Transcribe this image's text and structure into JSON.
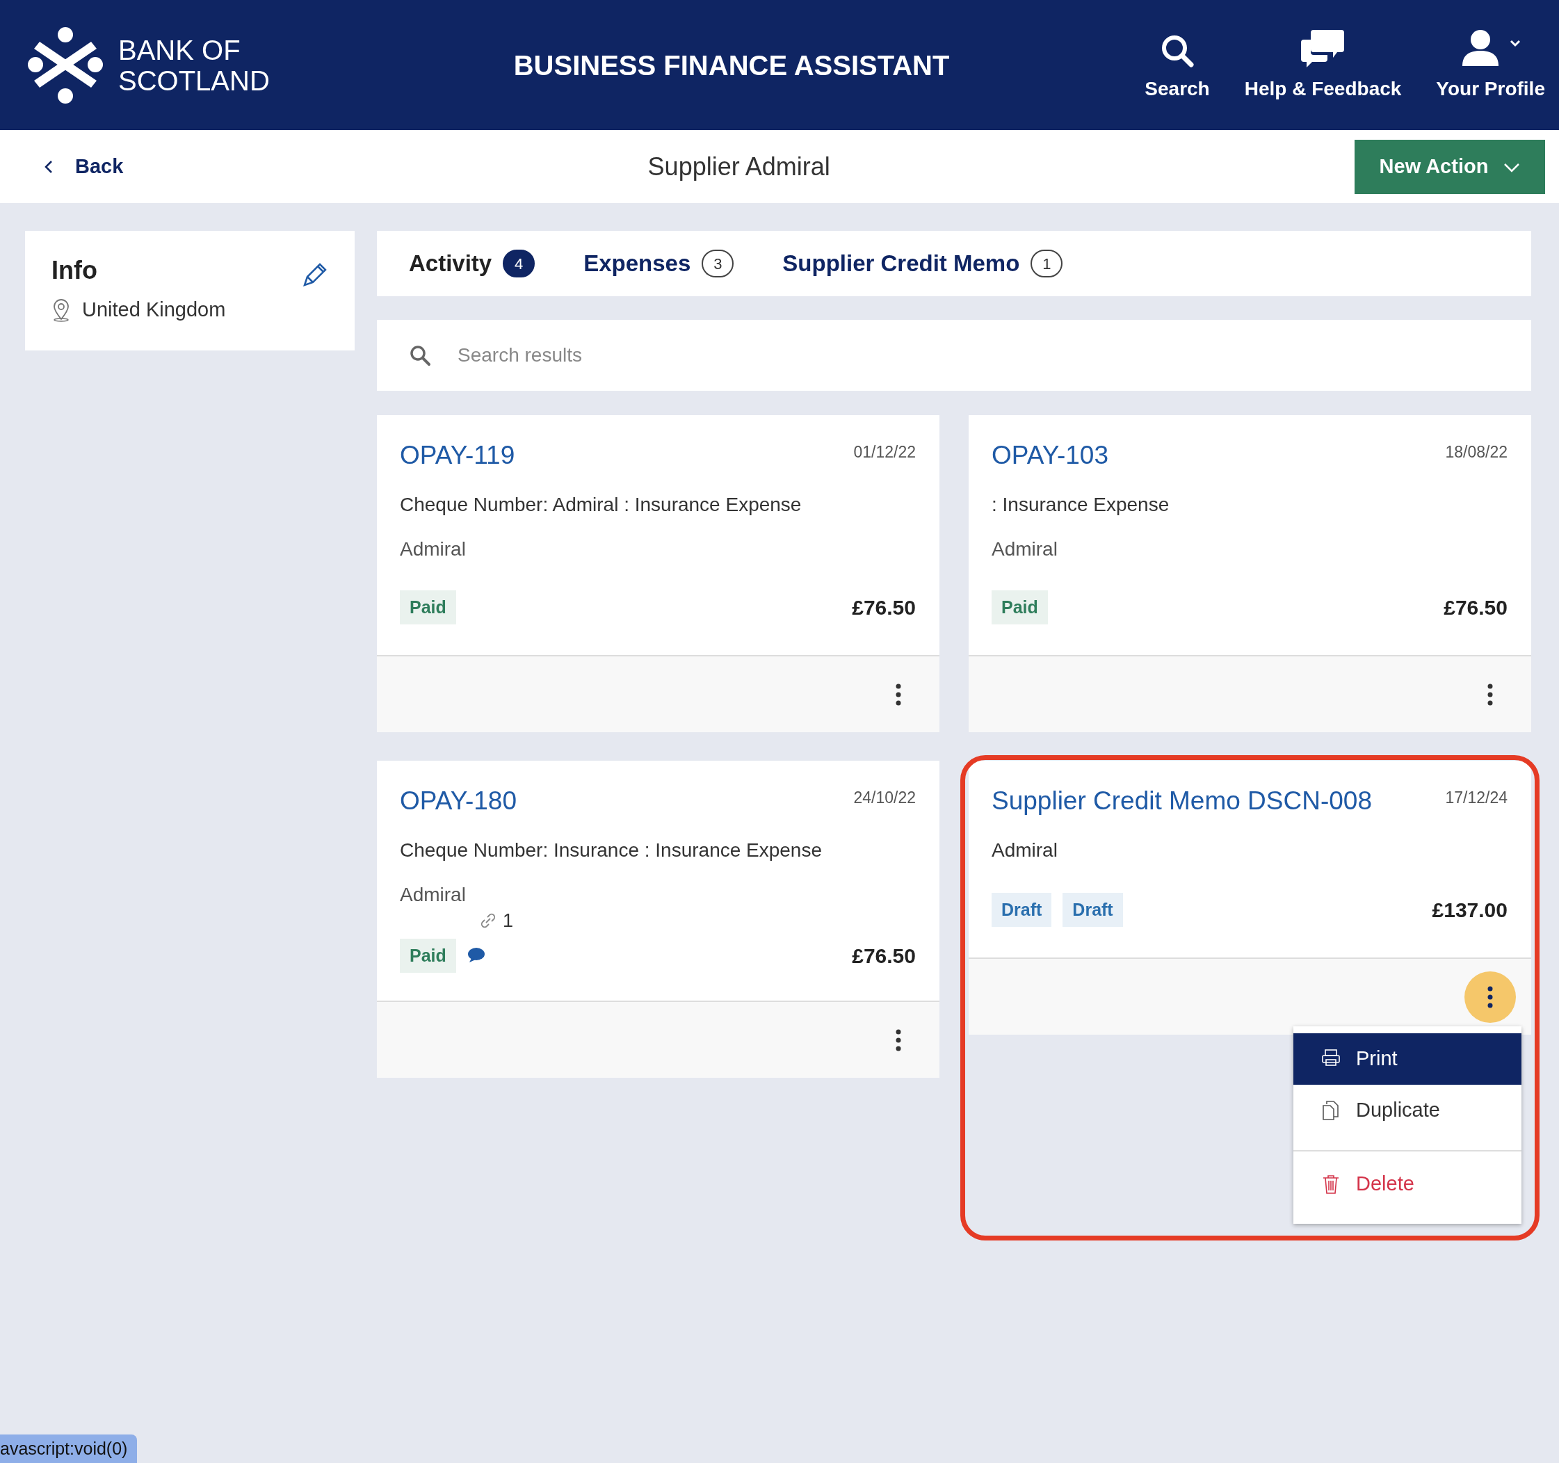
{
  "header": {
    "brand_line_1": "BANK OF",
    "brand_line_2": "SCOTLAND",
    "title": "BUSINESS FINANCE ASSISTANT",
    "actions": [
      {
        "kind": "search",
        "label": "Search"
      },
      {
        "kind": "help",
        "label": "Help & Feedback"
      },
      {
        "kind": "profile",
        "label": "Your Profile"
      }
    ]
  },
  "subheader": {
    "back": "Back",
    "title": "Supplier Admiral",
    "new_action": "New Action"
  },
  "info": {
    "title": "Info",
    "location": "United Kingdom"
  },
  "tabs": [
    {
      "label": "Activity",
      "count": "4",
      "selected": true
    },
    {
      "label": "Expenses",
      "count": "3",
      "selected": false
    },
    {
      "label": "Supplier Credit Memo",
      "count": "1",
      "selected": false
    }
  ],
  "search": {
    "placeholder": "Search results"
  },
  "cards": [
    {
      "title": "OPAY-119",
      "date": "01/12/22",
      "lines": [
        "Cheque Number: Admiral : Insurance Expense",
        "Admiral"
      ],
      "statuses": [
        {
          "label": "Paid",
          "kind": "paid"
        }
      ],
      "has_comment": false,
      "amount": "£76.50",
      "menu_open": false,
      "highlighted": false
    },
    {
      "title": "OPAY-103",
      "date": "18/08/22",
      "lines": [
        ": Insurance Expense",
        "Admiral"
      ],
      "statuses": [
        {
          "label": "Paid",
          "kind": "paid"
        }
      ],
      "has_comment": false,
      "amount": "£76.50",
      "menu_open": false,
      "highlighted": false
    },
    {
      "title": "OPAY-180",
      "date": "24/10/22",
      "lines": [
        "Cheque Number: Insurance : Insurance Expense",
        "Admiral"
      ],
      "attachments": "1",
      "statuses": [
        {
          "label": "Paid",
          "kind": "paid"
        }
      ],
      "has_comment": true,
      "amount": "£76.50",
      "menu_open": false,
      "highlighted": false
    },
    {
      "title": "Supplier Credit Memo DSCN-008",
      "date": "17/12/24",
      "lines": [
        "Admiral"
      ],
      "statuses": [
        {
          "label": "Draft",
          "kind": "draft"
        },
        {
          "label": "Draft",
          "kind": "draft"
        }
      ],
      "has_comment": false,
      "amount": "£137.00",
      "menu_open": true,
      "highlighted": true,
      "menu": [
        {
          "kind": "print",
          "label": "Print",
          "selected": true
        },
        {
          "kind": "duplicate",
          "label": "Duplicate",
          "selected": false
        },
        {
          "kind": "delete",
          "label": "Delete",
          "selected": false
        }
      ]
    }
  ],
  "status_bar": "avascript:void(0)"
}
